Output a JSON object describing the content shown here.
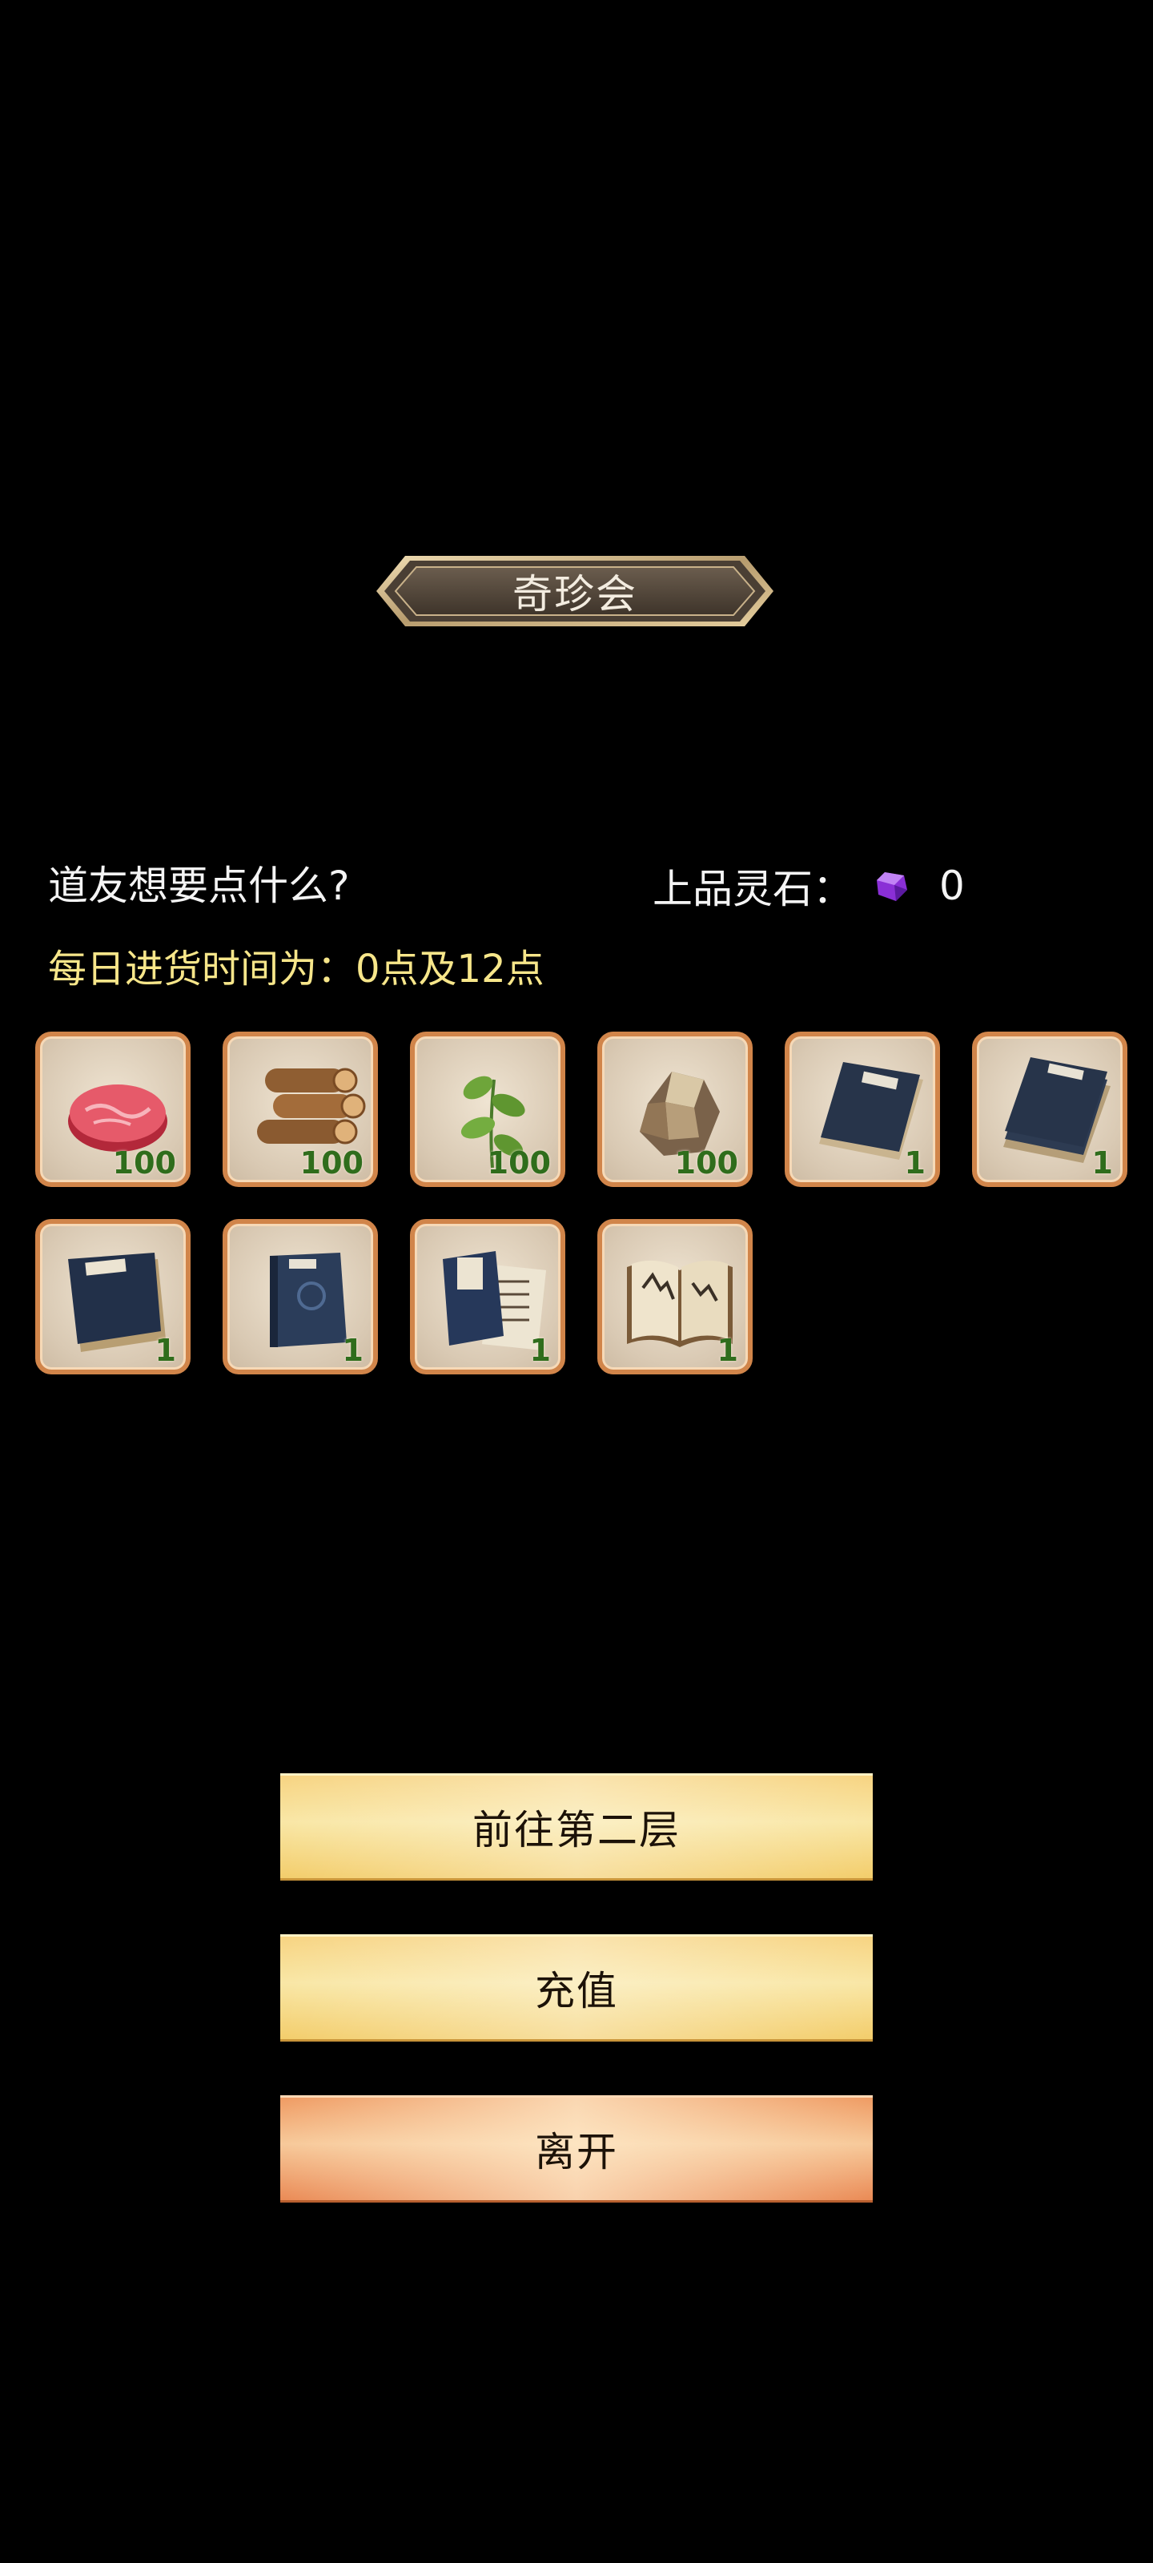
{
  "title": "奇珍会",
  "greeting": "道友想要点什么?",
  "currency": {
    "label": "上品灵石：",
    "icon": "purple-gem-icon",
    "amount": "0",
    "gem_color": "#8a2fd6"
  },
  "restock_notice": "每日进货时间为：0点及12点",
  "items": [
    {
      "name": "raw-meat-icon",
      "count": "100"
    },
    {
      "name": "wood-logs-icon",
      "count": "100"
    },
    {
      "name": "herb-plant-icon",
      "count": "100"
    },
    {
      "name": "ore-rock-icon",
      "count": "100"
    },
    {
      "name": "scroll-book-icon",
      "count": "1"
    },
    {
      "name": "stacked-books-icon",
      "count": "1"
    },
    {
      "name": "open-book-icon",
      "count": "1"
    },
    {
      "name": "blue-book-icon",
      "count": "1"
    },
    {
      "name": "book-and-pages-icon",
      "count": "1"
    },
    {
      "name": "illustrated-book-icon",
      "count": "1"
    }
  ],
  "buttons": {
    "next_floor": "前往第二层",
    "recharge": "充值",
    "leave": "离开"
  },
  "colors": {
    "background": "#000000",
    "notice_text": "#f7e68a",
    "slot_border": "#d1854a",
    "count_text": "#2f6d1c"
  }
}
